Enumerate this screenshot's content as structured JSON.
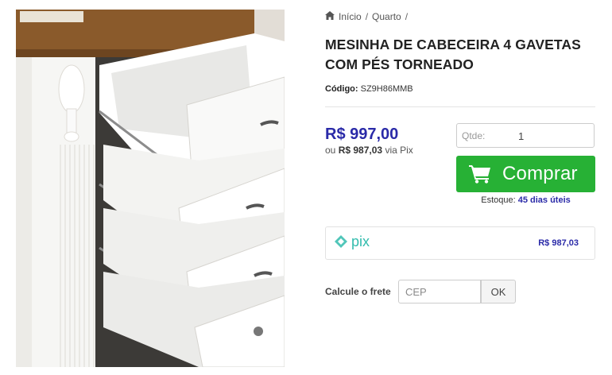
{
  "breadcrumb": {
    "home_icon": "home-icon",
    "items": [
      "Início",
      "Quarto"
    ],
    "separator": "/"
  },
  "product": {
    "image_alt": "Mesinha de cabeceira com gavetas abertas",
    "title": "MESINHA DE CABECEIRA 4 GAVETAS COM PÉS TORNEADO",
    "code_label": "Código:",
    "code_value": "SZ9H86MMB",
    "price": "R$ 997,00",
    "pix_prefix": "ou",
    "pix_price": "R$ 987,03",
    "pix_suffix": "via Pix"
  },
  "purchase": {
    "qty_label": "Qtde:",
    "qty_value": "1",
    "buy_label": "Comprar",
    "buy_icon": "cart-icon",
    "stock_label": "Estoque:",
    "stock_value": "45 dias úteis"
  },
  "pix_box": {
    "logo_text": "pix",
    "price": "R$ 987,03"
  },
  "shipping": {
    "label": "Calcule o frete",
    "placeholder": "CEP",
    "ok_label": "OK"
  },
  "colors": {
    "buy_button": "#27b135",
    "price": "#2a2aa8",
    "pix_logo": "#32bcad"
  }
}
